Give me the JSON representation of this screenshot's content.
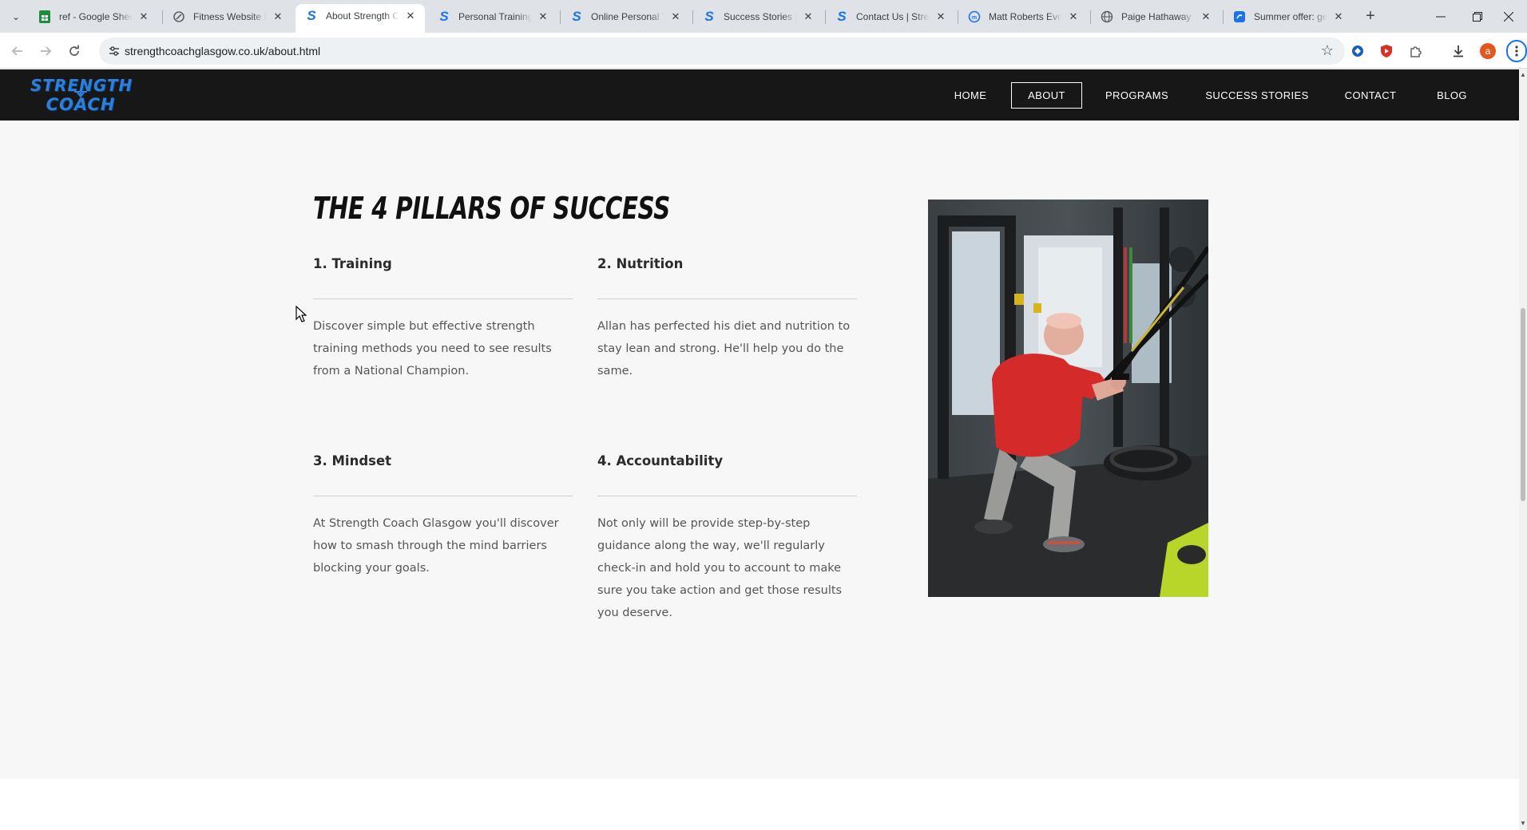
{
  "browser": {
    "tabs": [
      {
        "title": "ref - Google Sheets",
        "favicon": "sheets-icon",
        "color": "#1e8e3e",
        "active": false
      },
      {
        "title": "Fitness Website Design",
        "favicon": "link-icon",
        "color": "#5f6368",
        "active": false
      },
      {
        "title": "About Strength Coach",
        "favicon": "strength-coach-icon",
        "color": "#1a73e8",
        "active": true
      },
      {
        "title": "Personal Training",
        "favicon": "strength-coach-icon",
        "color": "#1a73e8",
        "active": false
      },
      {
        "title": "Online Personal Training",
        "favicon": "strength-coach-icon",
        "color": "#1a73e8",
        "active": false
      },
      {
        "title": "Success Stories | Strength",
        "favicon": "strength-coach-icon",
        "color": "#1a73e8",
        "active": false
      },
      {
        "title": "Contact Us | Strength",
        "favicon": "strength-coach-icon",
        "color": "#1a73e8",
        "active": false
      },
      {
        "title": "Matt Roberts Evolve",
        "favicon": "mr-icon",
        "color": "#1a73e8",
        "active": false
      },
      {
        "title": "Paige Hathaway",
        "favicon": "globe-icon",
        "color": "#5f6368",
        "active": false
      },
      {
        "title": "Summer offer: get",
        "favicon": "offer-icon",
        "color": "#1a73e8",
        "active": false
      }
    ],
    "url": "strengthcoachglasgow.co.uk/about.html",
    "profile_initial": "a"
  },
  "site": {
    "logo": {
      "line1": "STRENGTH",
      "line2": "COACH",
      "color": "#2e7fd8"
    },
    "menu": [
      {
        "label": "HOME",
        "active": false
      },
      {
        "label": "ABOUT",
        "active": true
      },
      {
        "label": "PROGRAMS",
        "active": false
      },
      {
        "label": "SUCCESS STORIES",
        "active": false
      },
      {
        "label": "CONTACT",
        "active": false
      },
      {
        "label": "BLOG",
        "active": false
      }
    ],
    "section": {
      "title": "THE 4 PILLARS OF SUCCESS",
      "pillars": [
        {
          "heading": "1. Training",
          "body": "Discover simple but effective strength training methods you need to see results from a National Champion."
        },
        {
          "heading": "2. Nutrition",
          "body": "Allan has perfected his diet and nutrition to stay lean and strong. He'll help you do the same."
        },
        {
          "heading": "3. Mindset",
          "body": "At Strength Coach Glasgow you'll discover how to smash through the mind barriers blocking your goals."
        },
        {
          "heading": "4. Accountability",
          "body": "Not only will be provide step-by-step guidance along the way, we'll regularly check-in and hold you to account to make sure you take action and get those results you deserve."
        }
      ]
    }
  }
}
